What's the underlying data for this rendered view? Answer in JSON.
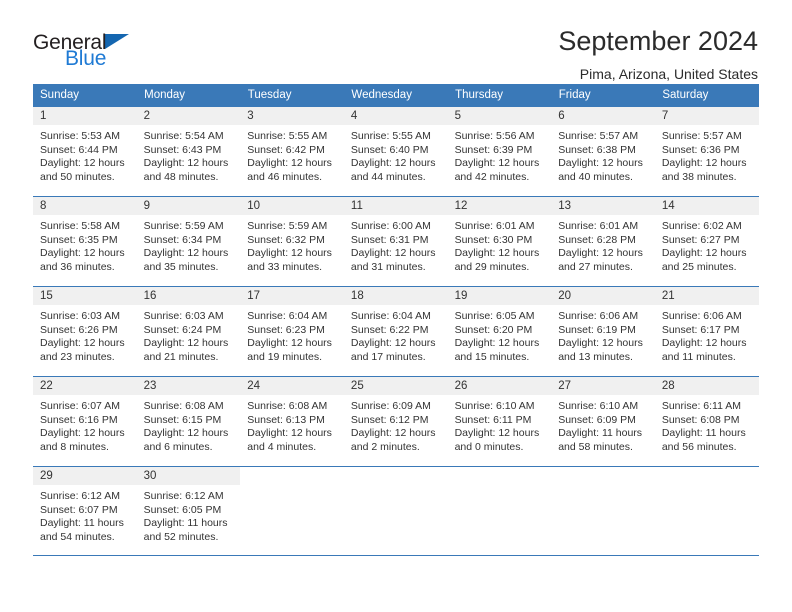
{
  "brand": {
    "name_part1": "General",
    "name_part2": "Blue",
    "triangle_color": "#1466b0",
    "blue_text_color": "#1f7ad4"
  },
  "header": {
    "title": "September 2024",
    "subtitle": "Pima, Arizona, United States"
  },
  "theme": {
    "header_bg": "#3a79b8",
    "header_text": "#ffffff",
    "daynum_bg": "#f0f0f0",
    "body_text": "#333333",
    "grid_line": "#3a79b8"
  },
  "weekdays": [
    "Sunday",
    "Monday",
    "Tuesday",
    "Wednesday",
    "Thursday",
    "Friday",
    "Saturday"
  ],
  "labels": {
    "sunrise_prefix": "Sunrise:",
    "sunset_prefix": "Sunset:",
    "daylight_prefix": "Daylight:"
  },
  "weeks": [
    [
      {
        "day": "1",
        "sunrise": "Sunrise: 5:53 AM",
        "sunset": "Sunset: 6:44 PM",
        "daylight_line1": "Daylight: 12 hours",
        "daylight_line2": "and 50 minutes."
      },
      {
        "day": "2",
        "sunrise": "Sunrise: 5:54 AM",
        "sunset": "Sunset: 6:43 PM",
        "daylight_line1": "Daylight: 12 hours",
        "daylight_line2": "and 48 minutes."
      },
      {
        "day": "3",
        "sunrise": "Sunrise: 5:55 AM",
        "sunset": "Sunset: 6:42 PM",
        "daylight_line1": "Daylight: 12 hours",
        "daylight_line2": "and 46 minutes."
      },
      {
        "day": "4",
        "sunrise": "Sunrise: 5:55 AM",
        "sunset": "Sunset: 6:40 PM",
        "daylight_line1": "Daylight: 12 hours",
        "daylight_line2": "and 44 minutes."
      },
      {
        "day": "5",
        "sunrise": "Sunrise: 5:56 AM",
        "sunset": "Sunset: 6:39 PM",
        "daylight_line1": "Daylight: 12 hours",
        "daylight_line2": "and 42 minutes."
      },
      {
        "day": "6",
        "sunrise": "Sunrise: 5:57 AM",
        "sunset": "Sunset: 6:38 PM",
        "daylight_line1": "Daylight: 12 hours",
        "daylight_line2": "and 40 minutes."
      },
      {
        "day": "7",
        "sunrise": "Sunrise: 5:57 AM",
        "sunset": "Sunset: 6:36 PM",
        "daylight_line1": "Daylight: 12 hours",
        "daylight_line2": "and 38 minutes."
      }
    ],
    [
      {
        "day": "8",
        "sunrise": "Sunrise: 5:58 AM",
        "sunset": "Sunset: 6:35 PM",
        "daylight_line1": "Daylight: 12 hours",
        "daylight_line2": "and 36 minutes."
      },
      {
        "day": "9",
        "sunrise": "Sunrise: 5:59 AM",
        "sunset": "Sunset: 6:34 PM",
        "daylight_line1": "Daylight: 12 hours",
        "daylight_line2": "and 35 minutes."
      },
      {
        "day": "10",
        "sunrise": "Sunrise: 5:59 AM",
        "sunset": "Sunset: 6:32 PM",
        "daylight_line1": "Daylight: 12 hours",
        "daylight_line2": "and 33 minutes."
      },
      {
        "day": "11",
        "sunrise": "Sunrise: 6:00 AM",
        "sunset": "Sunset: 6:31 PM",
        "daylight_line1": "Daylight: 12 hours",
        "daylight_line2": "and 31 minutes."
      },
      {
        "day": "12",
        "sunrise": "Sunrise: 6:01 AM",
        "sunset": "Sunset: 6:30 PM",
        "daylight_line1": "Daylight: 12 hours",
        "daylight_line2": "and 29 minutes."
      },
      {
        "day": "13",
        "sunrise": "Sunrise: 6:01 AM",
        "sunset": "Sunset: 6:28 PM",
        "daylight_line1": "Daylight: 12 hours",
        "daylight_line2": "and 27 minutes."
      },
      {
        "day": "14",
        "sunrise": "Sunrise: 6:02 AM",
        "sunset": "Sunset: 6:27 PM",
        "daylight_line1": "Daylight: 12 hours",
        "daylight_line2": "and 25 minutes."
      }
    ],
    [
      {
        "day": "15",
        "sunrise": "Sunrise: 6:03 AM",
        "sunset": "Sunset: 6:26 PM",
        "daylight_line1": "Daylight: 12 hours",
        "daylight_line2": "and 23 minutes."
      },
      {
        "day": "16",
        "sunrise": "Sunrise: 6:03 AM",
        "sunset": "Sunset: 6:24 PM",
        "daylight_line1": "Daylight: 12 hours",
        "daylight_line2": "and 21 minutes."
      },
      {
        "day": "17",
        "sunrise": "Sunrise: 6:04 AM",
        "sunset": "Sunset: 6:23 PM",
        "daylight_line1": "Daylight: 12 hours",
        "daylight_line2": "and 19 minutes."
      },
      {
        "day": "18",
        "sunrise": "Sunrise: 6:04 AM",
        "sunset": "Sunset: 6:22 PM",
        "daylight_line1": "Daylight: 12 hours",
        "daylight_line2": "and 17 minutes."
      },
      {
        "day": "19",
        "sunrise": "Sunrise: 6:05 AM",
        "sunset": "Sunset: 6:20 PM",
        "daylight_line1": "Daylight: 12 hours",
        "daylight_line2": "and 15 minutes."
      },
      {
        "day": "20",
        "sunrise": "Sunrise: 6:06 AM",
        "sunset": "Sunset: 6:19 PM",
        "daylight_line1": "Daylight: 12 hours",
        "daylight_line2": "and 13 minutes."
      },
      {
        "day": "21",
        "sunrise": "Sunrise: 6:06 AM",
        "sunset": "Sunset: 6:17 PM",
        "daylight_line1": "Daylight: 12 hours",
        "daylight_line2": "and 11 minutes."
      }
    ],
    [
      {
        "day": "22",
        "sunrise": "Sunrise: 6:07 AM",
        "sunset": "Sunset: 6:16 PM",
        "daylight_line1": "Daylight: 12 hours",
        "daylight_line2": "and 8 minutes."
      },
      {
        "day": "23",
        "sunrise": "Sunrise: 6:08 AM",
        "sunset": "Sunset: 6:15 PM",
        "daylight_line1": "Daylight: 12 hours",
        "daylight_line2": "and 6 minutes."
      },
      {
        "day": "24",
        "sunrise": "Sunrise: 6:08 AM",
        "sunset": "Sunset: 6:13 PM",
        "daylight_line1": "Daylight: 12 hours",
        "daylight_line2": "and 4 minutes."
      },
      {
        "day": "25",
        "sunrise": "Sunrise: 6:09 AM",
        "sunset": "Sunset: 6:12 PM",
        "daylight_line1": "Daylight: 12 hours",
        "daylight_line2": "and 2 minutes."
      },
      {
        "day": "26",
        "sunrise": "Sunrise: 6:10 AM",
        "sunset": "Sunset: 6:11 PM",
        "daylight_line1": "Daylight: 12 hours",
        "daylight_line2": "and 0 minutes."
      },
      {
        "day": "27",
        "sunrise": "Sunrise: 6:10 AM",
        "sunset": "Sunset: 6:09 PM",
        "daylight_line1": "Daylight: 11 hours",
        "daylight_line2": "and 58 minutes."
      },
      {
        "day": "28",
        "sunrise": "Sunrise: 6:11 AM",
        "sunset": "Sunset: 6:08 PM",
        "daylight_line1": "Daylight: 11 hours",
        "daylight_line2": "and 56 minutes."
      }
    ],
    [
      {
        "day": "29",
        "sunrise": "Sunrise: 6:12 AM",
        "sunset": "Sunset: 6:07 PM",
        "daylight_line1": "Daylight: 11 hours",
        "daylight_line2": "and 54 minutes."
      },
      {
        "day": "30",
        "sunrise": "Sunrise: 6:12 AM",
        "sunset": "Sunset: 6:05 PM",
        "daylight_line1": "Daylight: 11 hours",
        "daylight_line2": "and 52 minutes."
      },
      {
        "day": "",
        "sunrise": "",
        "sunset": "",
        "daylight_line1": "",
        "daylight_line2": ""
      },
      {
        "day": "",
        "sunrise": "",
        "sunset": "",
        "daylight_line1": "",
        "daylight_line2": ""
      },
      {
        "day": "",
        "sunrise": "",
        "sunset": "",
        "daylight_line1": "",
        "daylight_line2": ""
      },
      {
        "day": "",
        "sunrise": "",
        "sunset": "",
        "daylight_line1": "",
        "daylight_line2": ""
      },
      {
        "day": "",
        "sunrise": "",
        "sunset": "",
        "daylight_line1": "",
        "daylight_line2": ""
      }
    ]
  ]
}
